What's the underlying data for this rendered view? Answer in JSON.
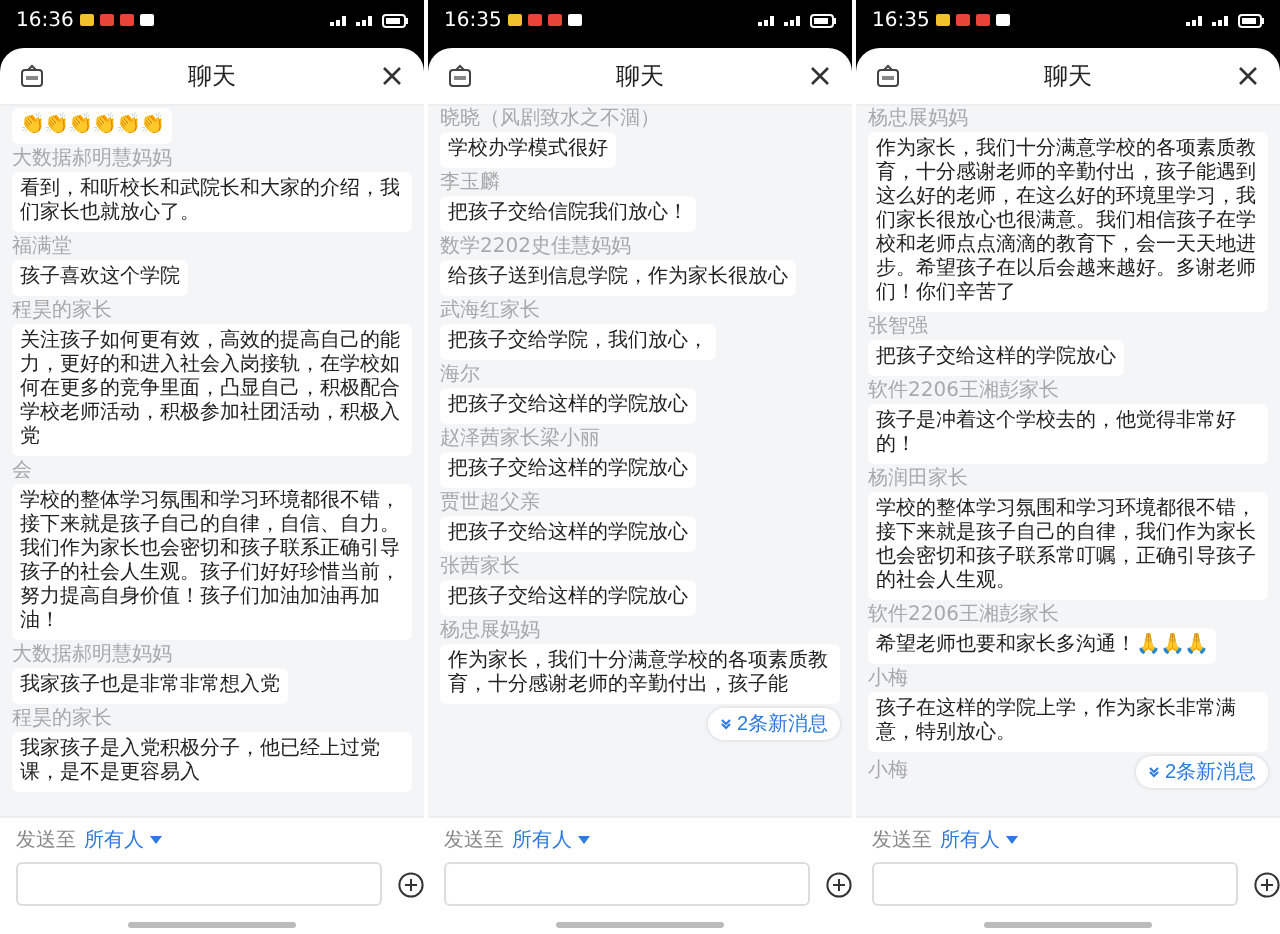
{
  "panels": [
    {
      "status_bar": {
        "time": "16:36"
      },
      "header": {
        "title": "聊天"
      },
      "messages": [
        {
          "text": "👏👏👏👏👏👏"
        },
        {
          "sender": "大数据郝明慧妈妈",
          "text": "看到，和听校长和武院长和大家的介绍，我们家长也就放心了。"
        },
        {
          "sender": "福满堂",
          "text": "孩子喜欢这个学院"
        },
        {
          "sender": "程昊的家长",
          "text": "关注孩子如何更有效，高效的提高自己的能力，更好的和进入社会入岗接轨，在学校如何在更多的竞争里面，凸显自己，积极配合学校老师活动，积极参加社团活动，积极入党"
        },
        {
          "sender": "会",
          "text": "学校的整体学习氛围和学习环境都很不错，接下来就是孩子自己的自律，自信、自力。我们作为家长也会密切和孩子联系正确引导孩子的社会人生观。孩子们好好珍惜当前，努力提高自身价值！孩子们加油加油再加油！"
        },
        {
          "sender": "大数据郝明慧妈妈",
          "text": "我家孩子也是非常非常想入党"
        },
        {
          "sender": "程昊的家长",
          "text": "我家孩子是入党积极分子，他已经上过党课，是不是更容易入"
        }
      ],
      "footer": {
        "send_to_label": "发送至",
        "recipient": "所有人"
      }
    },
    {
      "status_bar": {
        "time": "16:35"
      },
      "header": {
        "title": "聊天"
      },
      "messages": [
        {
          "sender": "晓晓（风剧致水之不涸）",
          "text": "学校办学模式很好"
        },
        {
          "sender": "李玉麟",
          "text": "把孩子交给信院我们放心！"
        },
        {
          "sender": "数学2202史佳慧妈妈",
          "text": "给孩子送到信息学院，作为家长很放心"
        },
        {
          "sender": "武海红家长",
          "text": "把孩子交给学院，我们放心，"
        },
        {
          "sender": "海尔",
          "text": "把孩子交给这样的学院放心"
        },
        {
          "sender": "赵泽茜家长梁小丽",
          "text": "把孩子交给这样的学院放心"
        },
        {
          "sender": "贾世超父亲",
          "text": "把孩子交给这样的学院放心"
        },
        {
          "sender": "张茜家长",
          "text": "把孩子交给这样的学院放心"
        },
        {
          "sender": "杨忠展妈妈",
          "text": "作为家长，我们十分满意学校的各项素质教育，十分感谢老师的辛勤付出，孩子能"
        }
      ],
      "new_messages": "2条新消息",
      "footer": {
        "send_to_label": "发送至",
        "recipient": "所有人"
      }
    },
    {
      "status_bar": {
        "time": "16:35"
      },
      "header": {
        "title": "聊天"
      },
      "messages": [
        {
          "sender": "杨忠展妈妈",
          "text": "作为家长，我们十分满意学校的各项素质教育，十分感谢老师的辛勤付出，孩子能遇到这么好的老师，在这么好的环境里学习，我们家长很放心也很满意。我们相信孩子在学校和老师点点滴滴的教育下，会一天天地进步。希望孩子在以后会越来越好。多谢老师们！你们辛苦了"
        },
        {
          "sender": "张智强",
          "text": "把孩子交给这样的学院放心"
        },
        {
          "sender": "软件2206王湘彭家长",
          "text": "孩子是冲着这个学校去的，他觉得非常好的！"
        },
        {
          "sender": "杨润田家长",
          "text": "学校的整体学习氛围和学习环境都很不错，接下来就是孩子自己的自律，我们作为家长也会密切和孩子联系常叮嘱，正确引导孩子的社会人生观。"
        },
        {
          "sender": "软件2206王湘彭家长",
          "text": "希望老师也要和家长多沟通！🙏🙏🙏"
        },
        {
          "sender": "小梅",
          "text": "孩子在这样的学院上学，作为家长非常满意，特别放心。"
        }
      ],
      "partial_sender": "小梅",
      "new_messages": "2条新消息",
      "footer": {
        "send_to_label": "发送至",
        "recipient": "所有人"
      }
    }
  ]
}
